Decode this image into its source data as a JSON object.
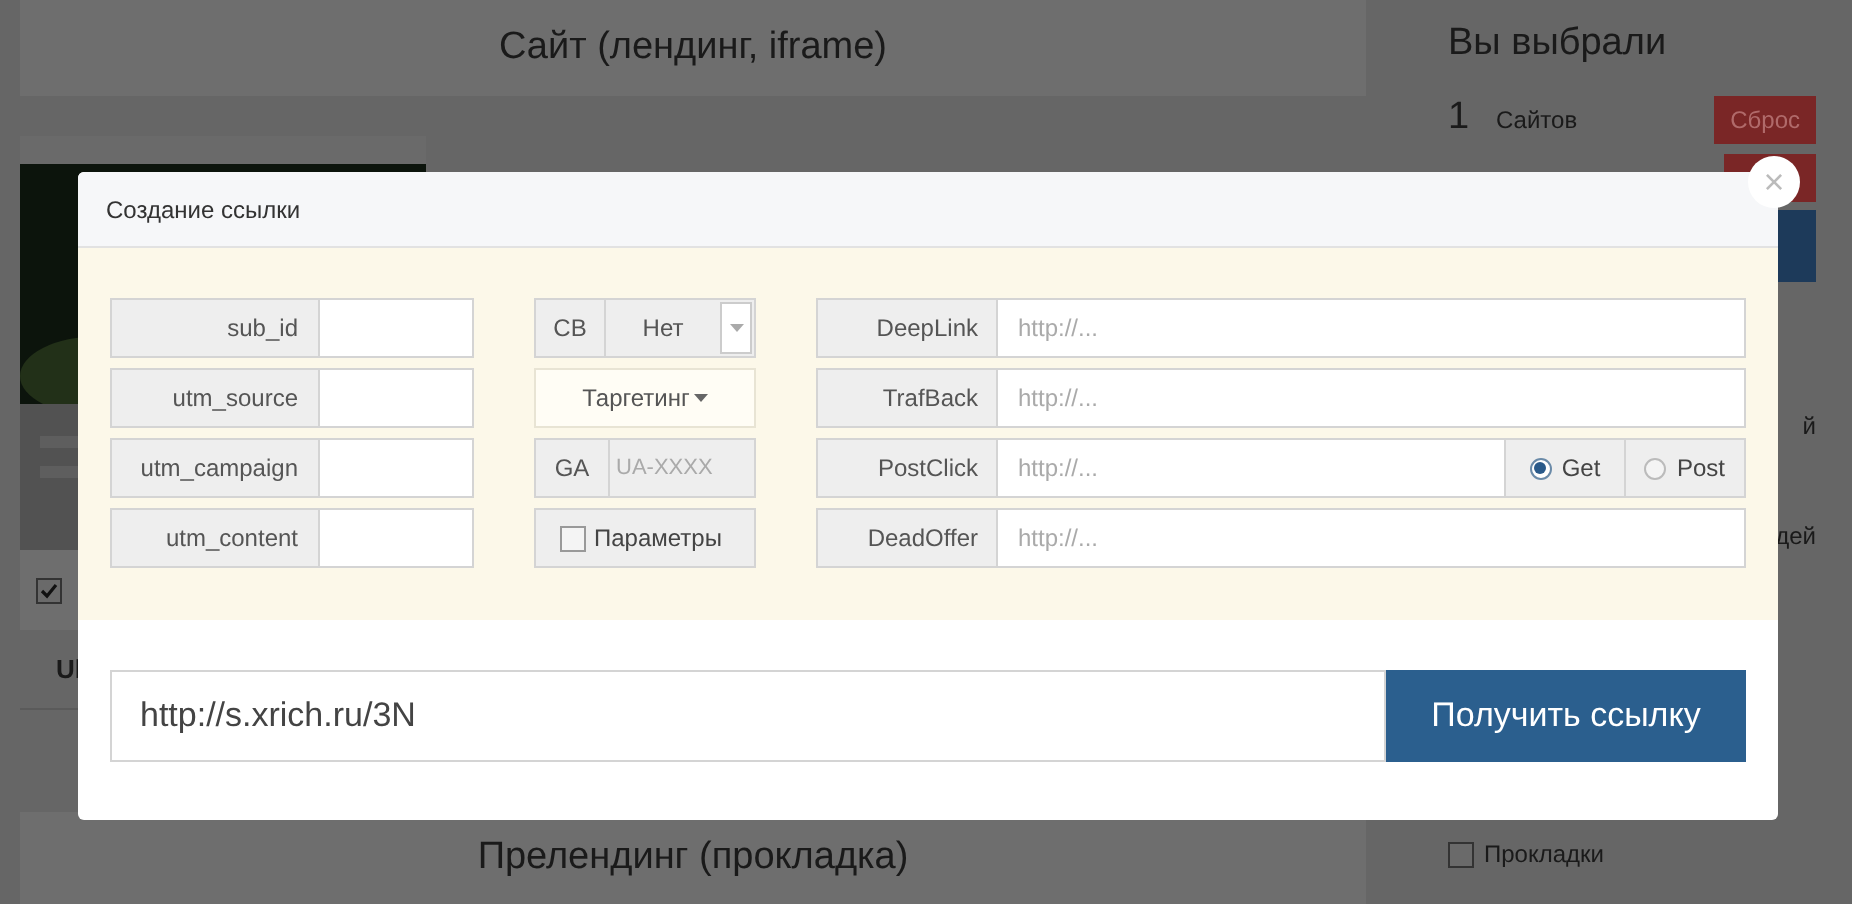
{
  "page": {
    "site_header": "Сайт (лендинг, iframe)",
    "agree_checkbox": {
      "checked": true
    },
    "column_1": "Ul",
    "prelanding_header": "Прелендинг (прокладка)"
  },
  "sidebar": {
    "title": "Вы выбрали",
    "selection_rows": [
      {
        "count": "1",
        "label": "Сайтов",
        "reset": "Сброс"
      }
    ],
    "partial_texts": [
      "й",
      "дей"
    ],
    "prelanding_option": {
      "label": "Прокладки",
      "checked": false
    }
  },
  "dialog": {
    "title": "Создание ссылки",
    "close": "×",
    "utm_fields": [
      {
        "label": "sub_id"
      },
      {
        "label": "utm_source"
      },
      {
        "label": "utm_campaign"
      },
      {
        "label": "utm_content"
      }
    ],
    "cb": {
      "label": "CB",
      "value": "Нет"
    },
    "targeting": "Таргетинг",
    "ga": {
      "label": "GA",
      "placeholder": "UA-XXXX"
    },
    "params": {
      "label": "Параметры",
      "checked": false
    },
    "url_fields": [
      {
        "label": "DeepLink",
        "placeholder": "http://..."
      },
      {
        "label": "TrafBack",
        "placeholder": "http://..."
      },
      {
        "label": "PostClick",
        "placeholder": "http://...",
        "methods": [
          {
            "label": "Get",
            "selected": true
          },
          {
            "label": "Post",
            "selected": false
          }
        ]
      },
      {
        "label": "DeadOffer",
        "placeholder": "http://..."
      }
    ],
    "link": "http://s.xrich.ru/3N",
    "get_link": "Получить ссылку"
  }
}
